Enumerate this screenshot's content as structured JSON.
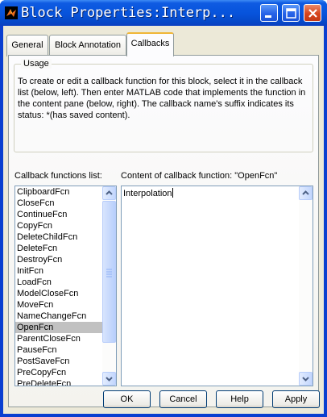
{
  "window": {
    "title": "Block Properties:Interp...",
    "controls": {
      "minimize": "minimize-icon",
      "maximize": "maximize-icon",
      "close": "close-icon"
    }
  },
  "tabs": [
    {
      "label": "General",
      "active": false
    },
    {
      "label": "Block Annotation",
      "active": false
    },
    {
      "label": "Callbacks",
      "active": true
    }
  ],
  "usage": {
    "title": "Usage",
    "text": "To create or edit a callback function for this block, select it in the callback list (below, left). Then enter MATLAB code that implements the function in the content pane (below, right). The callback name's suffix indicates its status: *(has saved content)."
  },
  "callbacks": {
    "list_label": "Callback functions list:",
    "items": [
      "ClipboardFcn",
      "CloseFcn",
      "ContinueFcn",
      "CopyFcn",
      "DeleteChildFcn",
      "DeleteFcn",
      "DestroyFcn",
      "InitFcn",
      "LoadFcn",
      "ModelCloseFcn",
      "MoveFcn",
      "NameChangeFcn",
      "OpenFcn",
      "ParentCloseFcn",
      "PauseFcn",
      "PostSaveFcn",
      "PreCopyFcn",
      "PreDeleteFcn"
    ],
    "selected": "OpenFcn",
    "content_label": "Content of callback function: \"OpenFcn\"",
    "content_value": "Interpolation"
  },
  "buttons": {
    "ok": "OK",
    "cancel": "Cancel",
    "help": "Help",
    "apply": "Apply"
  },
  "colors": {
    "titlebar": "#0754dc",
    "face": "#ece9d8",
    "selection": "#c1c1c1",
    "tab_accent": "#f0b636"
  }
}
